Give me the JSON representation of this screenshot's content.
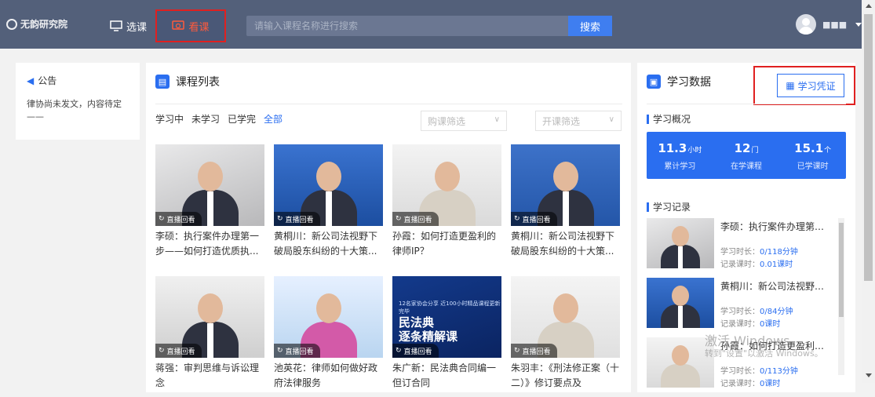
{
  "topbar": {
    "logo_text": "无韵研究院",
    "nav_select_label": "选课",
    "nav_watch_label": "看课",
    "search_placeholder": "请输入课程名称进行搜索",
    "search_button": "搜索",
    "user_name": "■■■"
  },
  "notice": {
    "title": "公告",
    "text": "律协尚未发文，内容待定——"
  },
  "courses": {
    "title": "课程列表",
    "tabs": [
      "学习中",
      "未学习",
      "已学完",
      "全部"
    ],
    "active_tab": "全部",
    "filter_buy": "购课筛选",
    "filter_open": "开课筛选",
    "replay_badge": "直播回看",
    "items": [
      {
        "title": "李硕：执行案件办理第一步——如何打造优质执..."
      },
      {
        "title": "黄桐川：新公司法视野下破局股东纠纷的十大策..."
      },
      {
        "title": "孙霞：如何打造更盈利的律师IP？"
      },
      {
        "title": "黄桐川：新公司法视野下破局股东纠纷的十大策..."
      },
      {
        "title": "蒋强：审判思维与诉讼理念"
      },
      {
        "title": "池英花：律师如何做好政府法律服务"
      },
      {
        "title": "朱广新：民法典合同编一但订合同"
      },
      {
        "title": "朱羽丰：《刑法修正案（十二）》修订要点及"
      }
    ],
    "promo": {
      "small_text": "12名家协会分享 近100小时精品课程更新完毕",
      "line1": "民法典",
      "line2": "逐条精解课"
    }
  },
  "stats": {
    "title": "学习数据",
    "cert_button": "学习凭证",
    "overview_label": "学习概况",
    "overview": [
      {
        "value": "11.3",
        "unit": "小时",
        "label": "累计学习"
      },
      {
        "value": "12",
        "unit": "门",
        "label": "在学课程"
      },
      {
        "value": "15.1",
        "unit": "个",
        "label": "已学课时"
      }
    ],
    "records_label": "学习记录",
    "duration_label": "学习时长：",
    "hours_label": "记录课时：",
    "records": [
      {
        "title": "李硕：执行案件办理第一...",
        "duration": "0/118分钟",
        "hours": "0.01课时"
      },
      {
        "title": "黄桐川：新公司法视野下...",
        "duration": "0/84分钟",
        "hours": "0课时"
      },
      {
        "title": "孙霞：如何打造更盈利的...",
        "duration": "0/113分钟",
        "hours": "0课时"
      }
    ]
  },
  "watermark": {
    "line1": "激活 Windows",
    "line2": "转到\"设置\"以激活 Windows。"
  },
  "colors": {
    "topbar": "#53607a",
    "accent": "#2a6ef0",
    "highlight": "#e02020"
  }
}
